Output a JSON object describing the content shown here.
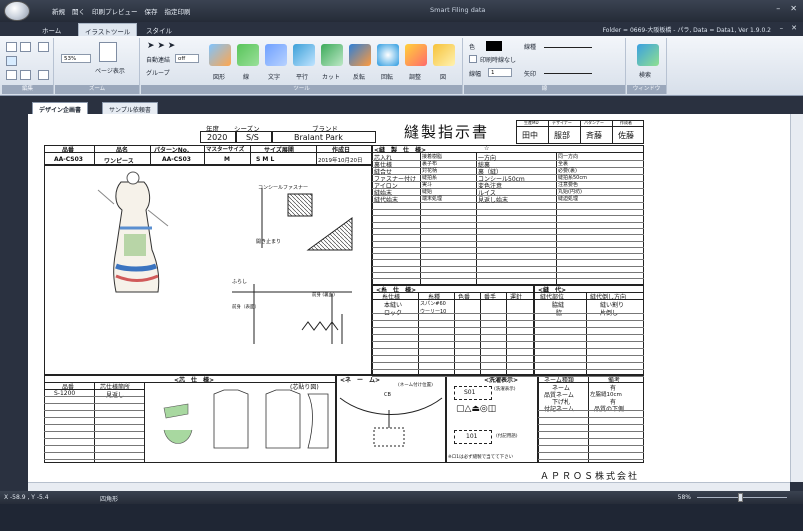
{
  "titlebar": {
    "quick_access": [
      "新規",
      "開く",
      "印刷プレビュー",
      "保存",
      "指定印刷"
    ],
    "app_title": "Smart Filing data"
  },
  "ribbon_tabs": [
    "ホーム",
    "イラストツール",
    "スタイル"
  ],
  "active_ribbon_tab": "イラストツール",
  "folio_info": "Folder = 0669-大阪板橋 - パラ, Data = Data1, Ver 1.9.0.2",
  "ribbon": {
    "groups": [
      "編集",
      "ズーム",
      "ツール",
      "線",
      "ウィンドウ"
    ],
    "zoom_value": "53%",
    "page_view": "ページ表示",
    "auto_connect_label": "自動連結",
    "auto_connect_value": "off",
    "group_label": "グループ",
    "tools": [
      "図形",
      "線",
      "文字",
      "平行",
      "カット",
      "反転",
      "回転",
      "調整",
      "図"
    ],
    "color_label": "色",
    "linetype_label": "線種",
    "print_none_label": "印刷時線なし",
    "linewidth_label": "線幅",
    "linewidth_value": "1",
    "arrow_label": "矢印",
    "search_label": "検索"
  },
  "doc_tabs": [
    "デザイン企画書",
    "サンプル依頼書"
  ],
  "active_doc_tab": "デザイン企画書",
  "sheet": {
    "year_label": "年度",
    "year": "2020",
    "season_label": "シーズン",
    "season": "S/S",
    "brand_label": "ブランド",
    "brand": "Bralant Park",
    "doc_title": "縫製指示書",
    "approvals": [
      {
        "role": "生産MD",
        "name": "田中"
      },
      {
        "role": "デザイナー",
        "name": "服部"
      },
      {
        "role": "パタンナー",
        "name": "斉藤"
      },
      {
        "role": "作成者",
        "name": "佐藤"
      }
    ],
    "header_cols": [
      "品番",
      "品名",
      "パターンNo.",
      "マスターサイズ",
      "サイズ展開",
      "作成日"
    ],
    "header_vals": [
      "AA-CS03",
      "ワンピース",
      "AA-CS03",
      "M",
      "S M L",
      "2019年10月20日"
    ],
    "sewing_spec_title": "<縫　製　仕　様>",
    "sewing_spec_mark": "☆",
    "sewing_rows": [
      [
        "芯入れ",
        "接着樹脂",
        "一方向",
        "同一方向"
      ],
      [
        "裏仕様",
        "裏子布",
        "総裏",
        "全裏"
      ],
      [
        "縫合せ",
        "対花柄",
        "裏（縫）",
        "必要(裏)"
      ],
      [
        "ファスナー付け",
        "縫拍糸",
        "コンシール50cm",
        "縫拍糸50cm"
      ],
      [
        "アイロン",
        "実斗",
        "変色注意",
        "注意要色"
      ],
      [
        "縫始末",
        "縫始",
        "ルイス",
        "丸始(円坊)"
      ],
      [
        "縫代始末",
        "端末処理",
        "見返し始末",
        "縫迫処理"
      ]
    ],
    "illustration_notes": {
      "zipper": "コンシールファスナー",
      "zip_end": "開き止まり",
      "hem": "ふらし",
      "front": "前身（表面）",
      "back_label": "前身\n(裏面)"
    },
    "thread_spec_title": "<糸　仕　様>",
    "thread_cols": [
      "糸仕様",
      "糸種",
      "色番",
      "番手",
      "運針"
    ],
    "thread_rows": [
      [
        "本縫い",
        "スパン#60",
        "",
        "",
        ""
      ],
      [
        "ロック",
        "ウーリー10",
        "",
        "",
        ""
      ]
    ],
    "seam_title": "<縫　代>",
    "seam_cols": [
      "縫代部位",
      "縫代倒し方向"
    ],
    "seam_rows": [
      [
        "脇縫",
        "縫い割り"
      ],
      [
        "脇",
        "片倒し"
      ]
    ],
    "fabric_title": "<芯　仕　様>",
    "fabric_cols": [
      "品番",
      "芯仕様箇所"
    ],
    "fabric_rows": [
      [
        "S-1200",
        "見返し"
      ]
    ],
    "fabric_note": "(芯貼り図)",
    "name_title": "<ネ　ー　ム>",
    "name_position": "(ネーム付け位置)",
    "cb_label": "CB",
    "care_title": "<洗濯表示>",
    "care_code": "S01",
    "care_note": "(洗濯表示)",
    "care_code2": "101",
    "care_note2": "(付記用語)",
    "care_footer": "※ロ1は必ず縫製で当てて下さい",
    "name_cols": [
      "ネーム種類",
      "備考"
    ],
    "name_rows": [
      [
        "ネーム",
        "有"
      ],
      [
        "品質ネーム",
        "左脇縫10cm"
      ],
      [
        "下げ札",
        "有"
      ],
      [
        "付記ネーム",
        "品質の下側"
      ]
    ],
    "company": "ＡＰＲＯＳ株式会社"
  },
  "status": {
    "coord": "X -58.9 , Y -5.4",
    "mode": "四角形",
    "zoom": "58%"
  }
}
